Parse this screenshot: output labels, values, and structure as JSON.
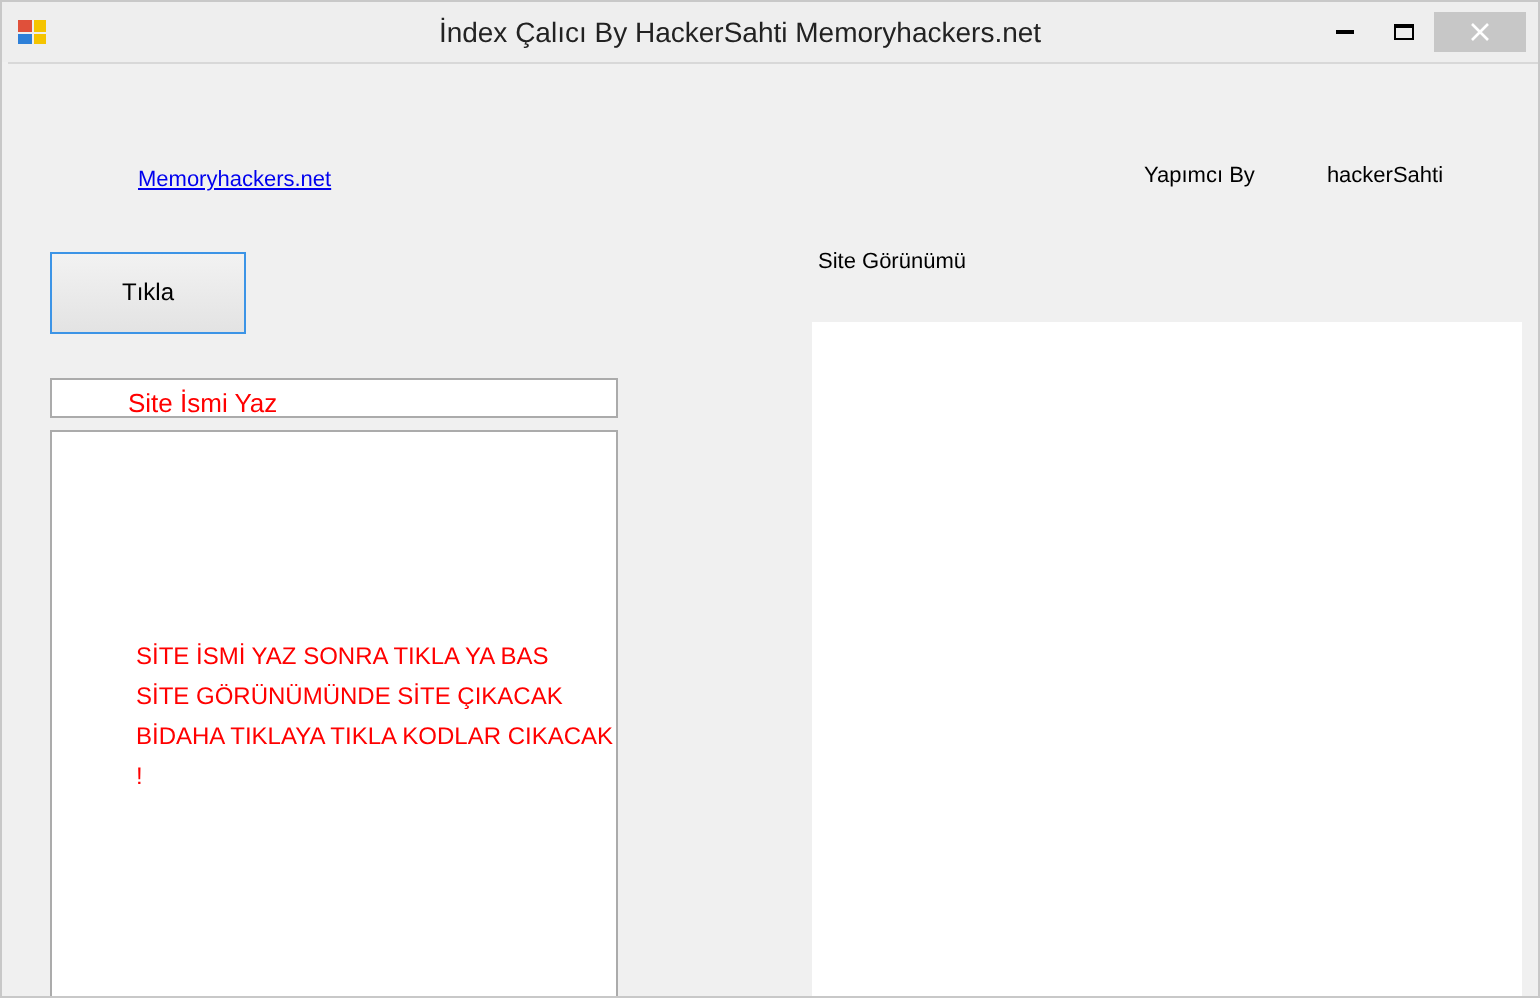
{
  "window": {
    "title": "İndex Çalıcı By HackerSahti Memoryhackers.net"
  },
  "link": "Memoryhackers.net",
  "author_label": "Yapımcı By",
  "author_name": "hackerSahti",
  "button": "Tıkla",
  "site_field": {
    "value": "Site İsmi Yaz"
  },
  "site_view_label": "Site Görünümü",
  "code_box": {
    "lines": [
      "SİTE İSMİ YAZ SONRA TIKLA YA BAS",
      "SİTE GÖRÜNÜMÜNDE SİTE ÇIKACAK",
      "BİDAHA TIKLAYA TIKLA KODLAR CIKACAK",
      "!"
    ]
  }
}
